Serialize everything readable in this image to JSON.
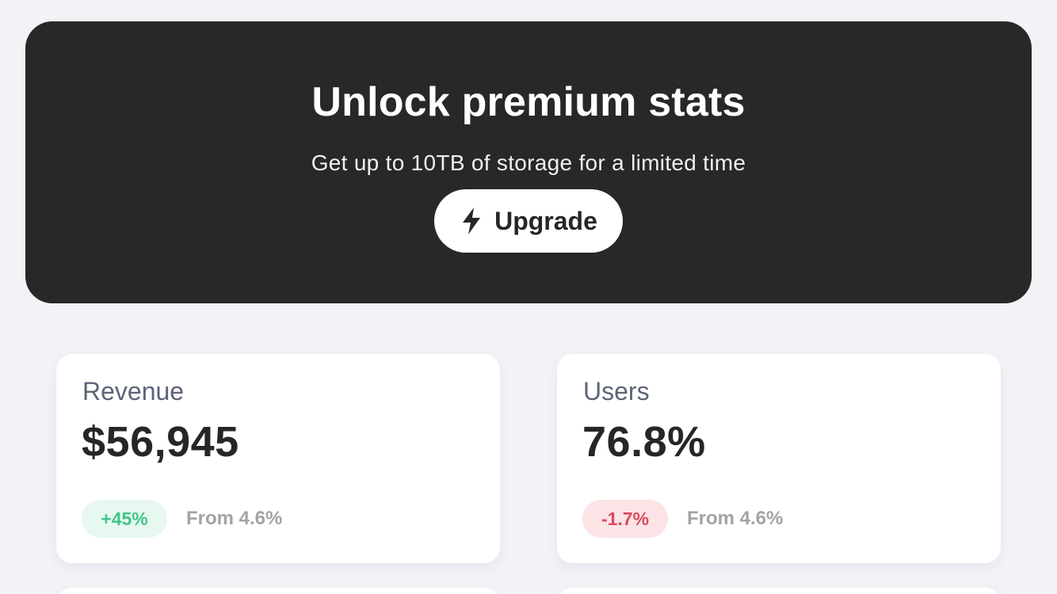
{
  "hero": {
    "title": "Unlock premium stats",
    "subtitle": "Get up to 10TB of storage for a limited time",
    "button_label": "Upgrade",
    "button_icon": "lightning-bolt-icon",
    "background_color": "#282828"
  },
  "stats": [
    {
      "label": "Revenue",
      "value": "$56,945",
      "delta": "+45%",
      "delta_trend": "up",
      "delta_color": "#43c38b",
      "comparison": "From 4.6%"
    },
    {
      "label": "Users",
      "value": "76.8%",
      "delta": "-1.7%",
      "delta_trend": "down",
      "delta_color": "#d94a5c",
      "comparison": "From 4.6%"
    }
  ]
}
